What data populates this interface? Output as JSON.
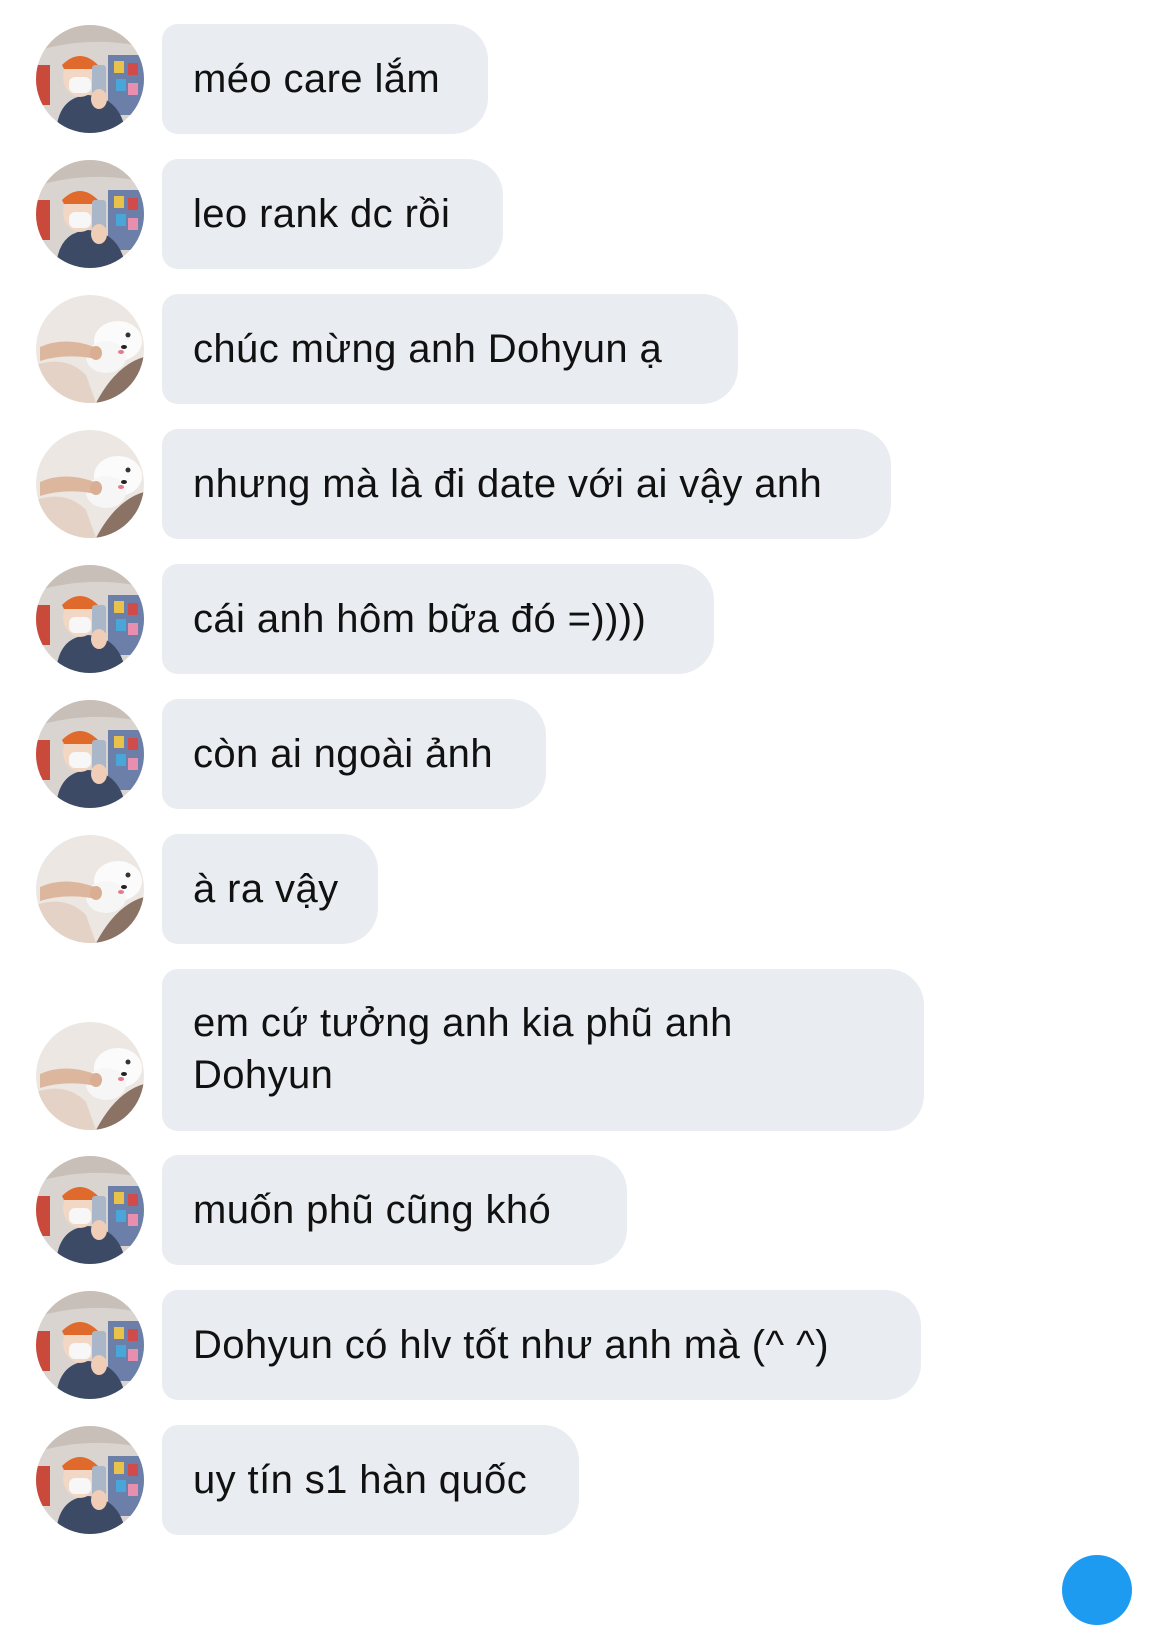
{
  "conversation": {
    "avatars": {
      "a": "avatar-selfie-orange-cap",
      "b": "avatar-white-dog"
    },
    "messages": [
      {
        "sender": "a",
        "text": "méo care lắm"
      },
      {
        "sender": "a",
        "text": "leo rank dc rồi"
      },
      {
        "sender": "b",
        "text": "chúc mừng anh Dohyun ạ"
      },
      {
        "sender": "b",
        "text": "nhưng mà là đi date với ai vậy anh"
      },
      {
        "sender": "a",
        "text": "cái anh hôm bữa đó =))))"
      },
      {
        "sender": "a",
        "text": "còn ai ngoài ảnh"
      },
      {
        "sender": "b",
        "text": "à ra vậy"
      },
      {
        "sender": "b",
        "text": "em cứ tưởng anh kia phũ anh Dohyun"
      },
      {
        "sender": "a",
        "text": "muốn phũ cũng khó"
      },
      {
        "sender": "a",
        "text": "Dohyun có hlv tốt như anh mà (^ ^)"
      },
      {
        "sender": "a",
        "text": "uy tín s1 hàn quốc"
      }
    ]
  },
  "colors": {
    "bubble_bg": "#e9ecf0",
    "text": "#111111",
    "accent": "#1d9bf0"
  }
}
